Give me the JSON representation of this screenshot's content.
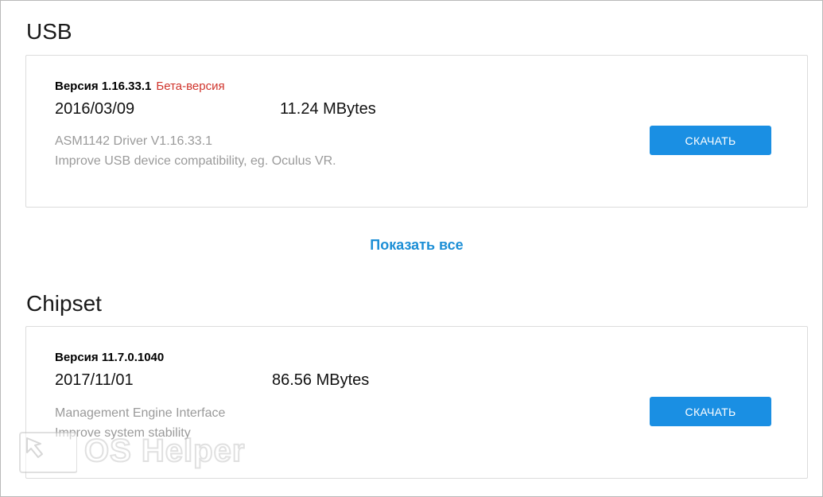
{
  "usb": {
    "title": "USB",
    "version": "Версия 1.16.33.1",
    "beta_label": "Бета-версия",
    "date": "2016/03/09",
    "size": "11.24 MBytes",
    "desc_line1": "ASM1142 Driver V1.16.33.1",
    "desc_line2": "Improve USB device compatibility, eg. Oculus VR.",
    "download_label": "СКАЧАТЬ"
  },
  "show_all_label": "Показать все",
  "chipset": {
    "title": "Chipset",
    "version": "Версия 11.7.0.1040",
    "date": "2017/11/01",
    "size": "86.56 MBytes",
    "desc_line1": "Management Engine Interface",
    "desc_line2": "Improve system stability",
    "download_label": "СКАЧАТЬ"
  },
  "watermark": {
    "text": "OS Helper",
    "icon": "cursor-arrow-icon"
  },
  "colors": {
    "accent": "#1a8fe3",
    "link": "#1d8fd6",
    "beta": "#d0342c",
    "muted_text": "#9a9a9a"
  }
}
